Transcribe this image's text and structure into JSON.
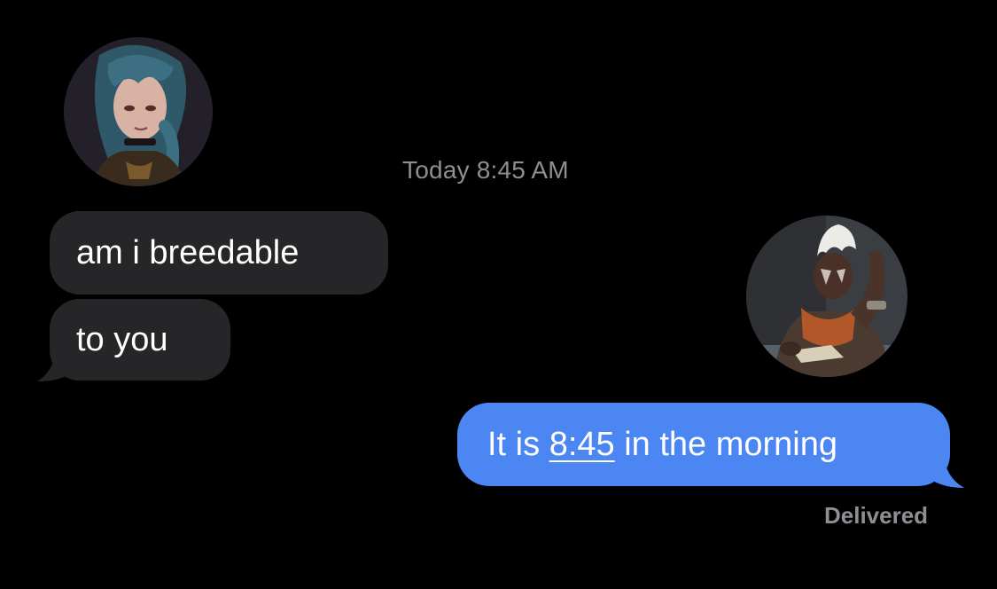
{
  "thread": {
    "timestamp_day": "Today",
    "timestamp_time": "8:45 AM"
  },
  "messages": {
    "incoming": [
      {
        "text": "am i breedable"
      },
      {
        "text": "to you"
      }
    ],
    "outgoing": {
      "text_before": "It is",
      "time_link": "8:45",
      "text_after": "in the morning",
      "status": "Delivered"
    }
  },
  "avatars": {
    "left": "contact-avatar-icon",
    "right": "sender-avatar-icon"
  },
  "colors": {
    "background": "#000000",
    "incoming_bubble": "#262629",
    "outgoing_bubble": "#4c86f3",
    "meta_text": "#8e8e93"
  }
}
